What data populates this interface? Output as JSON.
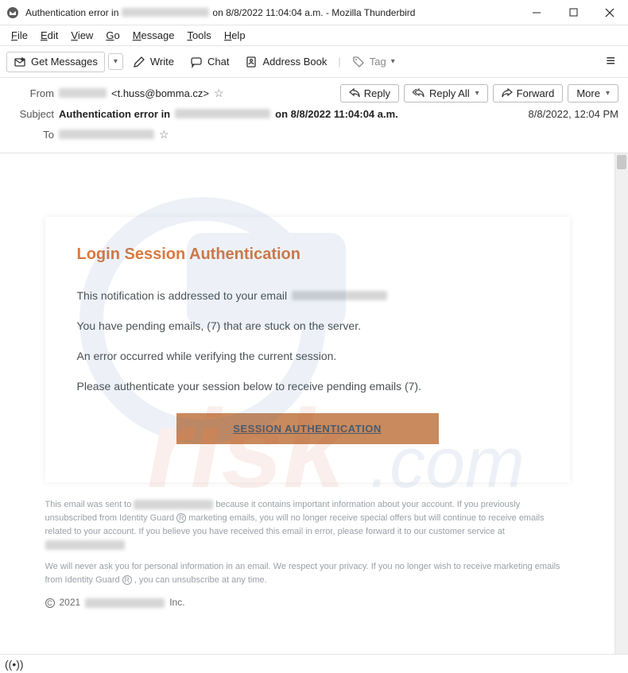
{
  "window": {
    "title_prefix": "Authentication error in",
    "title_suffix": "on 8/8/2022 11:04:04 a.m. - Mozilla Thunderbird"
  },
  "menu": {
    "file": "File",
    "edit": "Edit",
    "view": "View",
    "go": "Go",
    "message": "Message",
    "tools": "Tools",
    "help": "Help"
  },
  "toolbar": {
    "get_messages": "Get Messages",
    "write": "Write",
    "chat": "Chat",
    "address_book": "Address Book",
    "tag": "Tag"
  },
  "headers": {
    "from_label": "From",
    "from_email": "<t.huss@bomma.cz>",
    "subject_label": "Subject",
    "subject_prefix": "Authentication error in",
    "subject_suffix": "on 8/8/2022 11:04:04 a.m.",
    "to_label": "To",
    "date": "8/8/2022, 12:04 PM"
  },
  "actions": {
    "reply": "Reply",
    "reply_all": "Reply All",
    "forward": "Forward",
    "more": "More"
  },
  "email": {
    "heading": "Login Session Authentication",
    "line1": "This notification is addressed to your email",
    "line2": "You have pending emails, (7) that are stuck on the server.",
    "line3": "An error occurred while verifying the current session.",
    "line4": "Please authenticate your session below to receive pending emails (7).",
    "button": "SESSION AUTHENTICATION"
  },
  "footer": {
    "p1a": "This email was sent to",
    "p1b": "because it contains important information about your account. If you previously unsubscribed from Identity Guard",
    "p1c": "marketing emails, you will no longer receive special offers but will continue to receive emails related to your account. If you believe you have received this email in error, please forward it to our customer service at",
    "p2a": "We will never ask you for personal information in an email. We respect your privacy. If you no longer wish to receive marketing emails from Identity Guard",
    "p2b": ", you can unsubscribe at any time.",
    "copyright_year": "2021",
    "copyright_suffix": "Inc."
  }
}
